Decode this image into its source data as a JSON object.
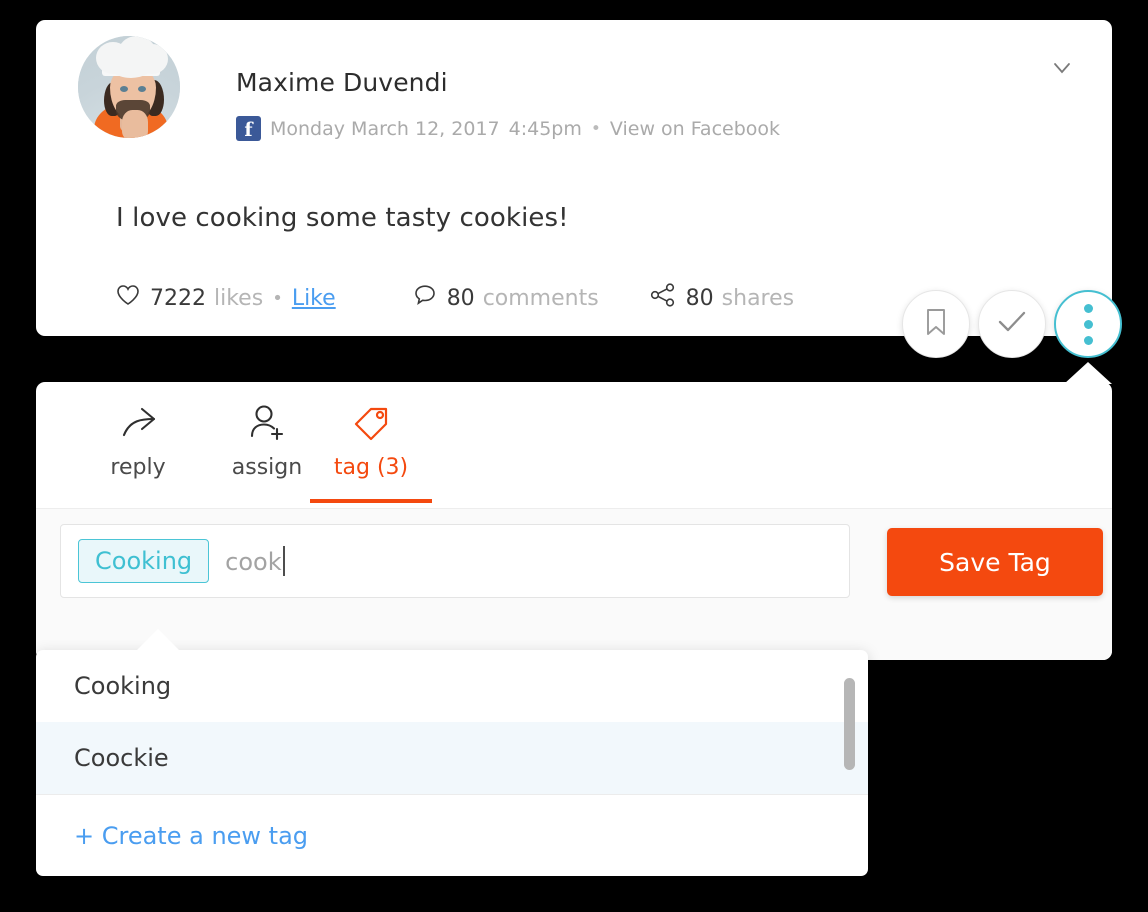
{
  "post": {
    "author": "Maxime Duvendi",
    "network_icon": "facebook-icon",
    "date": "Monday March 12, 2017",
    "time": "4:45pm",
    "separator": "•",
    "source_link": "View on Facebook",
    "text": "I love cooking some tasty cookies!",
    "collapse_icon": "chevron-down-icon",
    "engagement": {
      "likes_count": "7222",
      "likes_label": "likes",
      "likes_separator": "•",
      "like_action": "Like",
      "comments_count": "80",
      "comments_label": "comments",
      "shares_count": "80",
      "shares_label": "shares",
      "heart_icon": "heart-icon",
      "comment_icon": "comment-bubble-icon",
      "share_icon": "share-nodes-icon"
    },
    "actions": [
      {
        "name": "bookmark-button",
        "icon": "bookmark-icon",
        "active": false
      },
      {
        "name": "approve-button",
        "icon": "check-icon",
        "active": false
      },
      {
        "name": "more-button",
        "icon": "more-vertical-icon",
        "active": true
      }
    ]
  },
  "panel": {
    "tabs": [
      {
        "label": "reply",
        "icon": "reply-arrow-icon",
        "active": false
      },
      {
        "label": "assign",
        "icon": "user-plus-icon",
        "active": false
      },
      {
        "label": "tag (3)",
        "icon": "tag-icon",
        "active": true
      }
    ],
    "tag_input": {
      "chip": "Cooking",
      "typed_value": "cook",
      "placeholder": "cook"
    },
    "save_button": "Save Tag"
  },
  "dropdown": {
    "options": [
      {
        "label": "Cooking",
        "highlighted": false
      },
      {
        "label": "Coockie",
        "highlighted": true
      }
    ],
    "create_option": "+ Create a new tag"
  },
  "colors": {
    "accent_orange": "#f4490f",
    "accent_cyan": "#45bfd1",
    "link_blue": "#4a9df0",
    "facebook_blue": "#3b5998",
    "highlight_row": "#f2f8fc",
    "panel_body": "#fafafa"
  }
}
